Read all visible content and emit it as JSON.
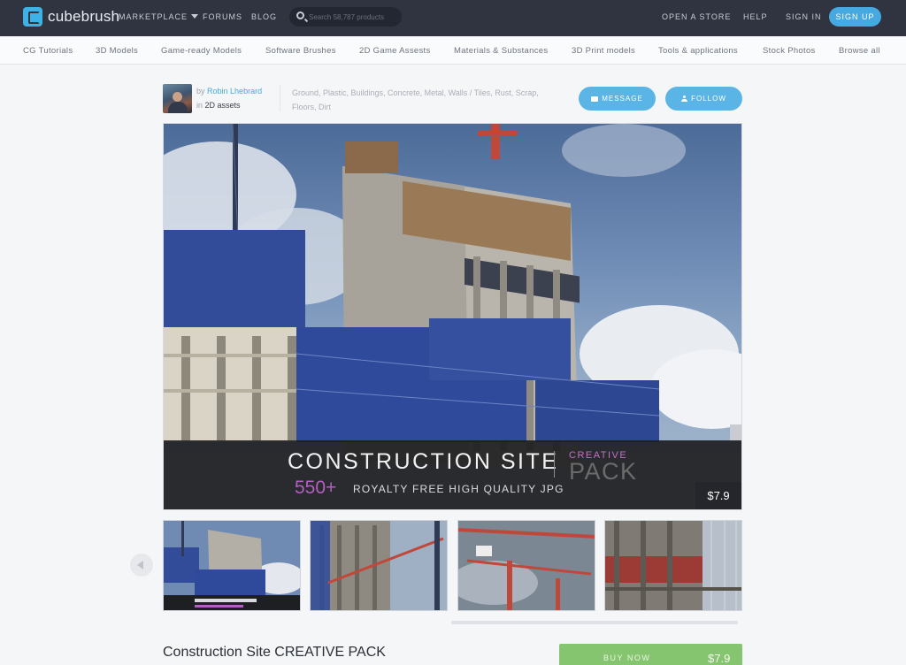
{
  "brand": {
    "name": "cubebrush"
  },
  "topnav": {
    "marketplace": "MARKETPLACE",
    "forums": "FORUMS",
    "blog": "BLOG",
    "search_placeholder": "Search 58,787 products",
    "open_store": "OPEN A STORE",
    "help": "HELP",
    "sign_in": "SIGN IN",
    "sign_up": "SIGN UP"
  },
  "categories": [
    "CG Tutorials",
    "3D Models",
    "Game-ready Models",
    "Software Brushes",
    "2D Game Assests",
    "Materials & Substances",
    "3D Print models",
    "Tools & applications",
    "Stock Photos",
    "Browse all"
  ],
  "author": {
    "by_prefix": "by",
    "name": "Robin Lhebrard",
    "in_prefix": "in",
    "category": "2D assets"
  },
  "tags": "Ground, Plastic, Buildings, Concrete, Metal, Walls / Tiles, Rust, Scrap, Floors, Dirt",
  "actions": {
    "message": "MESSAGE",
    "follow": "FOLLOW"
  },
  "hero": {
    "title": "CONSTRUCTION SITE",
    "tag": "CREATIVE",
    "pack": "PACK",
    "count": "550+",
    "subtitle": "ROYALTY FREE HIGH QUALITY JPG",
    "price": "$7.9"
  },
  "product": {
    "title": "Construction Site CREATIVE PACK",
    "buy_label": "BUY NOW",
    "price": "$7.9"
  },
  "colors": {
    "nav_bg": "#2f3440",
    "accent": "#46a9e0",
    "buy_green": "#86c56f",
    "banner_purple": "#b45fc2"
  }
}
